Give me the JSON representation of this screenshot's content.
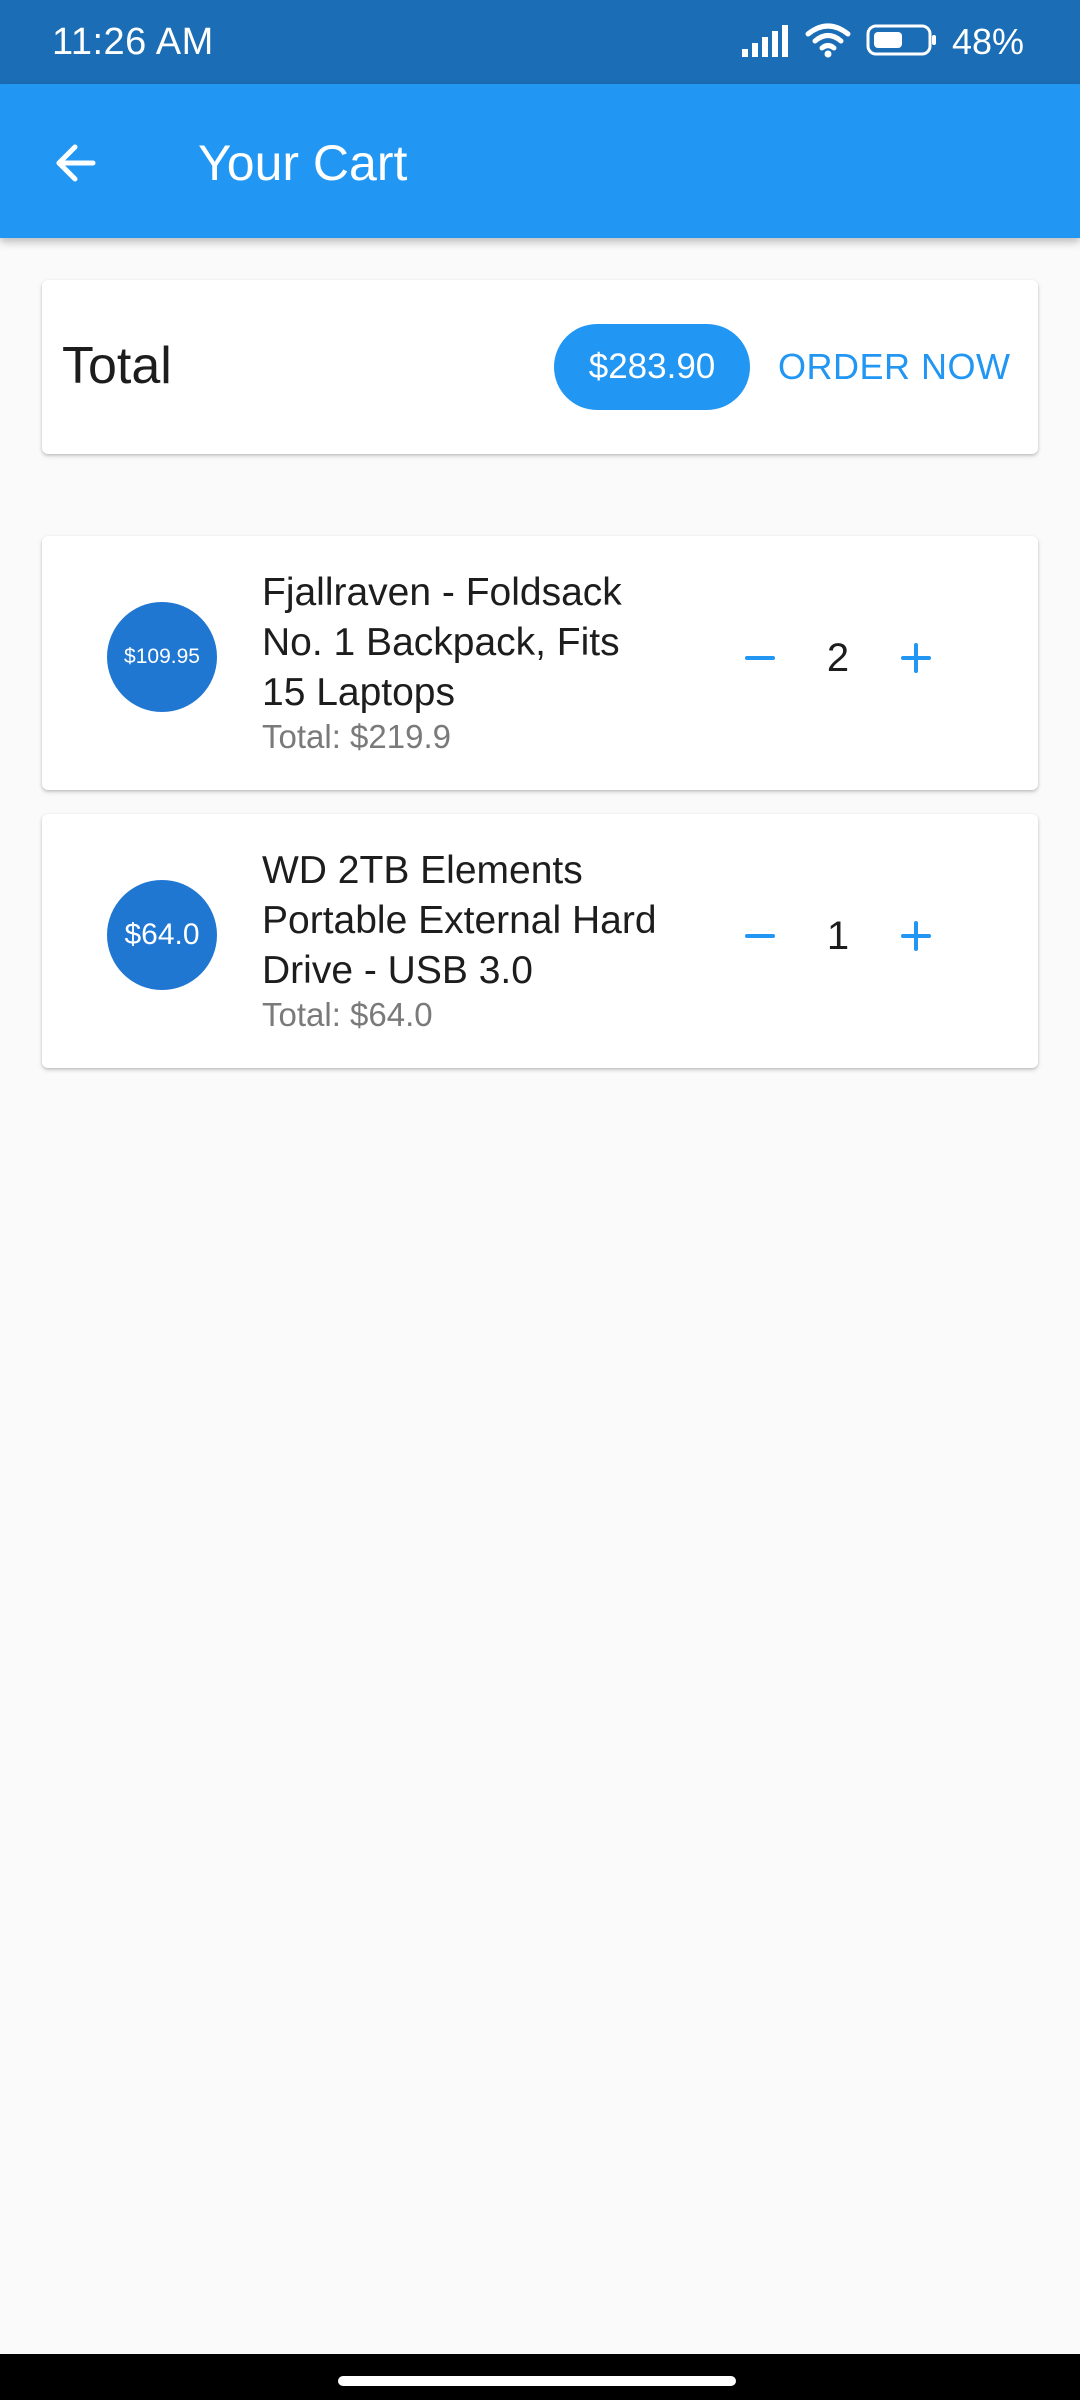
{
  "status_bar": {
    "time": "11:26 AM",
    "battery": "48%",
    "icons": [
      "signal-icon",
      "wifi-icon",
      "battery-icon"
    ]
  },
  "app_bar": {
    "title": "Your Cart",
    "back_icon": "arrow-back-icon"
  },
  "summary": {
    "label": "Total",
    "amount": "$283.90",
    "order_button": "ORDER NOW"
  },
  "items": [
    {
      "price": "$109.95",
      "title": "Fjallraven - Foldsack No. 1 Backpack, Fits 15 Laptops",
      "subtotal": "Total: $219.9",
      "quantity": "2"
    },
    {
      "price": "$64.0",
      "title": "WD 2TB Elements Portable External Hard Drive - USB 3.0",
      "subtotal": "Total: $64.0",
      "quantity": "1"
    }
  ],
  "colors": {
    "status_bar": "#1b6db5",
    "app_bar": "#2196f3",
    "accent": "#2196f3",
    "avatar": "#1f77d2",
    "background": "#fafafa"
  }
}
